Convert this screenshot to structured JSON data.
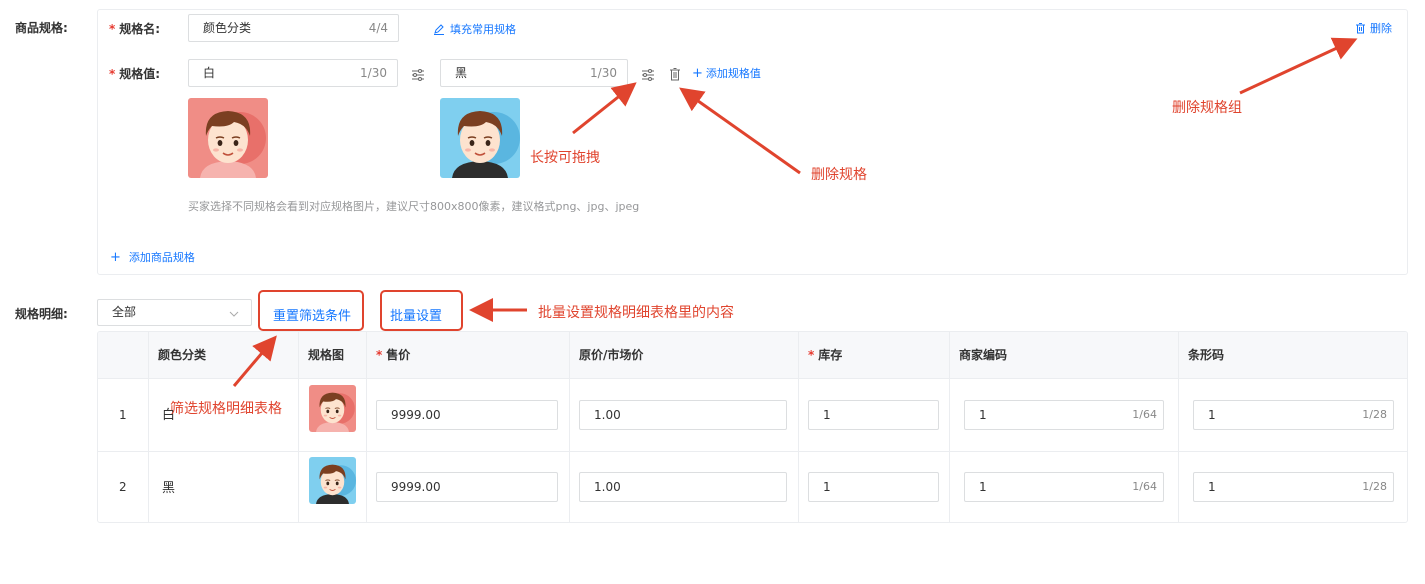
{
  "spec_section": {
    "label": "商品规格:",
    "name_label": "规格名:",
    "name_value": "颜色分类",
    "name_count": "4/4",
    "fill_common": "填充常用规格",
    "delete_group": "删除",
    "value_label": "规格值:",
    "values": [
      {
        "text": "白",
        "count": "1/30"
      },
      {
        "text": "黑",
        "count": "1/30"
      }
    ],
    "add_value": "添加规格值",
    "hint": "买家选择不同规格会看到对应规格图片，建议尺寸800x800像素，建议格式png、jpg、jpeg",
    "add_spec": "添加商品规格"
  },
  "detail_section": {
    "label": "规格明细:",
    "filter_value": "全部",
    "reset_filter": "重置筛选条件",
    "batch_set": "批量设置",
    "columns": [
      "颜色分类",
      "规格图",
      "售价",
      "原价/市场价",
      "库存",
      "商家编码",
      "条形码"
    ],
    "rows": [
      {
        "index": "1",
        "color": "白",
        "price": "9999.00",
        "original": "1.00",
        "stock": "1",
        "code": "1",
        "code_count": "1/64",
        "barcode": "1",
        "barcode_count": "1/28"
      },
      {
        "index": "2",
        "color": "黑",
        "price": "9999.00",
        "original": "1.00",
        "stock": "1",
        "code": "1",
        "code_count": "1/64",
        "barcode": "1",
        "barcode_count": "1/28"
      }
    ]
  },
  "annotations": {
    "delete_group": "删除规格组",
    "drag": "长按可拖拽",
    "delete_spec": "删除规格",
    "batch": "批量设置规格明细表格里的内容",
    "filter": "筛选规格明细表格"
  },
  "colors": {
    "accent": "#1677ff",
    "annotation": "#e0442e",
    "required": "#e63a30",
    "avatar_pink": "#f08d86",
    "avatar_blue": "#7fcfef"
  }
}
